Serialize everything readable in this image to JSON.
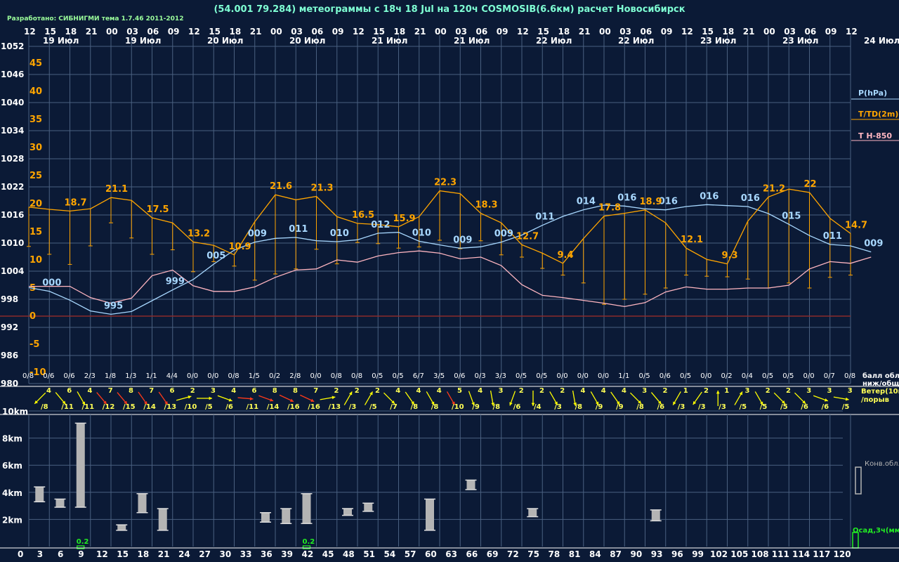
{
  "header": {
    "title": "(54.001 79.284) метеограммы с  18ч 18 Jul на 120ч COSMOSIB(6.6км) расчет Новосибирск",
    "credit": "Разработано: СИБНИГМИ тема 1.7.46 2011-2012"
  },
  "colors": {
    "background": "#0b1a36",
    "grid": "#4a6080",
    "pressure": "#a8d8ff",
    "temperature": "#ffa500",
    "t850": "#ffb6c1",
    "zero_line": "#8b2a2a",
    "wind_yellow": "#ffff00",
    "wind_red": "#ff3a1a",
    "cloud_bars": "#b4b4b4",
    "precip": "#22ee22"
  },
  "chart_data": {
    "type": "line",
    "hour_ticks": [
      "12",
      "15",
      "18",
      "21",
      "00",
      "03",
      "06",
      "09",
      "12",
      "15",
      "18",
      "21",
      "00",
      "03",
      "06",
      "09",
      "12",
      "15",
      "18",
      "21",
      "00",
      "03",
      "06",
      "09",
      "12",
      "15",
      "18",
      "21",
      "00",
      "03",
      "06",
      "09",
      "12",
      "15",
      "18",
      "21",
      "00",
      "03",
      "06",
      "09",
      "12"
    ],
    "date_labels": [
      "19 Июл",
      "19 Июл",
      "20 Июл",
      "20 Июл",
      "21 Июл",
      "21 Июл",
      "22 Июл",
      "22 Июл",
      "23 Июл",
      "23 Июл",
      "24 Июл"
    ],
    "pressure_axis": {
      "label": "P(hPa)",
      "ticks": [
        "1052",
        "1046",
        "1040",
        "1034",
        "1028",
        "1022",
        "1016",
        "1010",
        "1004",
        "998",
        "992",
        "986",
        "980"
      ]
    },
    "temperature_axis": {
      "label": "T/TD(2m)",
      "ticks": [
        "45",
        "40",
        "35",
        "30",
        "25",
        "20",
        "15",
        "10",
        "5",
        "0",
        "-5",
        "-10"
      ]
    },
    "t850_label": "T H-850",
    "pressure_labels": [
      {
        "i": 1,
        "t": "000"
      },
      {
        "i": 4,
        "t": "995"
      },
      {
        "i": 7,
        "t": "999"
      },
      {
        "i": 9,
        "t": "005"
      },
      {
        "i": 11,
        "t": "009"
      },
      {
        "i": 13,
        "t": "011"
      },
      {
        "i": 15,
        "t": "010"
      },
      {
        "i": 17,
        "t": "012"
      },
      {
        "i": 19,
        "t": "010"
      },
      {
        "i": 21,
        "t": "009"
      },
      {
        "i": 23,
        "t": "009"
      },
      {
        "i": 25,
        "t": "011"
      },
      {
        "i": 27,
        "t": "014"
      },
      {
        "i": 29,
        "t": "016"
      },
      {
        "i": 31,
        "t": "016"
      },
      {
        "i": 33,
        "t": "016"
      },
      {
        "i": 35,
        "t": "016"
      },
      {
        "i": 37,
        "t": "015"
      },
      {
        "i": 39,
        "t": "011"
      },
      {
        "i": 41,
        "t": "009"
      }
    ],
    "pressure_hpa": [
      1000.5,
      999.7,
      997.8,
      995.5,
      994.8,
      995.4,
      997.7,
      1000.0,
      1002.2,
      1005.5,
      1008.5,
      1010.2,
      1011.0,
      1011.2,
      1010.5,
      1010.3,
      1010.7,
      1012.1,
      1012.3,
      1010.4,
      1009.6,
      1008.9,
      1009.2,
      1010.2,
      1011.7,
      1013.8,
      1015.7,
      1017.1,
      1018.1,
      1017.9,
      1017.3,
      1017.1,
      1017.8,
      1018.2,
      1018.0,
      1017.8,
      1016.3,
      1014.0,
      1011.6,
      1009.7,
      1009.4,
      1008.1
    ],
    "temperature_c": [
      19.4,
      19.0,
      18.7,
      19.1,
      21.1,
      20.6,
      17.5,
      16.6,
      13.2,
      12.6,
      10.9,
      16.8,
      21.6,
      20.7,
      21.3,
      17.7,
      16.5,
      16.3,
      15.9,
      17.7,
      22.3,
      21.8,
      18.3,
      16.6,
      12.7,
      11.2,
      9.4,
      13.8,
      17.8,
      18.3,
      18.9,
      16.6,
      12.1,
      10.1,
      9.3,
      16.9,
      21.2,
      22.6,
      22.0,
      17.4,
      14.7
    ],
    "dewpoint_c": [
      12.4,
      11.0,
      9.2,
      12.5,
      16.6,
      13.9,
      11.0,
      11.8,
      7.9,
      9.7,
      8.9,
      6.4,
      7.5,
      8.4,
      11.9,
      9.3,
      13.1,
      12.9,
      12.1,
      12.3,
      13.5,
      12.0,
      13.4,
      10.9,
      10.5,
      8.5,
      7.3,
      5.9,
      2.1,
      3.0,
      3.9,
      5.0,
      7.3,
      7.1,
      7.0,
      6.6,
      5.0,
      5.9,
      5.0,
      6.9,
      7.3
    ],
    "temperature_labels": [
      {
        "i": 2,
        "t": "18.7"
      },
      {
        "i": 4,
        "t": "21.1"
      },
      {
        "i": 6,
        "t": "17.5"
      },
      {
        "i": 8,
        "t": "13.2"
      },
      {
        "i": 10,
        "t": "10.9"
      },
      {
        "i": 12,
        "t": "21.6"
      },
      {
        "i": 14,
        "t": "21.3"
      },
      {
        "i": 16,
        "t": "16.5"
      },
      {
        "i": 18,
        "t": "15.9"
      },
      {
        "i": 20,
        "t": "22.3"
      },
      {
        "i": 22,
        "t": "18.3"
      },
      {
        "i": 24,
        "t": "12.7"
      },
      {
        "i": 26,
        "t": "9.4"
      },
      {
        "i": 28,
        "t": "17.8"
      },
      {
        "i": 30,
        "t": "18.9"
      },
      {
        "i": 32,
        "t": "12.1"
      },
      {
        "i": 34,
        "t": "9.3"
      },
      {
        "i": 36,
        "t": "21.2"
      },
      {
        "i": 38,
        "t": "22"
      },
      {
        "i": 40,
        "t": "14.7"
      }
    ],
    "t850_c": [
      5.3,
      5.3,
      5.3,
      3.3,
      2.3,
      3.2,
      7.2,
      8.2,
      5.4,
      4.4,
      4.4,
      5.2,
      6.9,
      8.2,
      8.4,
      10.0,
      9.6,
      10.7,
      11.3,
      11.6,
      11.2,
      10.2,
      10.5,
      9.0,
      5.6,
      3.7,
      3.3,
      2.8,
      2.3,
      1.7,
      2.4,
      4.3,
      5.2,
      4.8,
      4.8,
      5.0,
      5.0,
      5.5,
      8.4,
      9.7,
      9.4,
      10.5
    ],
    "cloud_cover": [
      "0/8",
      "0/6",
      "0/6",
      "2/3",
      "1/8",
      "1/3",
      "1/1",
      "4/4",
      "0/0",
      "0/0",
      "0/8",
      "1/5",
      "0/2",
      "2/8",
      "0/0",
      "0/8",
      "0/8",
      "0/5",
      "0/5",
      "6/7",
      "3/5",
      "0/6",
      "0/3",
      "3/3",
      "0/5",
      "0/5",
      "0/0",
      "0/0",
      "0/0",
      "1/1",
      "0/5",
      "0/6",
      "0/5",
      "0/0",
      "0/2",
      "0/4",
      "0/5",
      "0/5",
      "0/0",
      "0/7",
      "0/8"
    ],
    "cloud_label": "балл обл. ниж/общ",
    "wind": [
      {
        "s": "4",
        "g": "/8",
        "a": 225,
        "c": "y"
      },
      {
        "s": "6",
        "g": "/11",
        "a": 140,
        "c": "y"
      },
      {
        "s": "4",
        "g": "/11",
        "a": 150,
        "c": "y"
      },
      {
        "s": "7",
        "g": "/12",
        "a": 140,
        "c": "r"
      },
      {
        "s": "8",
        "g": "/15",
        "a": 140,
        "c": "r"
      },
      {
        "s": "7",
        "g": "/14",
        "a": 145,
        "c": "r"
      },
      {
        "s": "6",
        "g": "/13",
        "a": 145,
        "c": "r"
      },
      {
        "s": "2",
        "g": "/10",
        "a": 75,
        "c": "y"
      },
      {
        "s": "3",
        "g": "/5",
        "a": 90,
        "c": "y"
      },
      {
        "s": "4",
        "g": "/6",
        "a": 110,
        "c": "y"
      },
      {
        "s": "6",
        "g": "/11",
        "a": 95,
        "c": "r"
      },
      {
        "s": "8",
        "g": "/14",
        "a": 110,
        "c": "r"
      },
      {
        "s": "8",
        "g": "/16",
        "a": 115,
        "c": "r"
      },
      {
        "s": "7",
        "g": "/16",
        "a": 115,
        "c": "r"
      },
      {
        "s": "2",
        "g": "/13",
        "a": 80,
        "c": "y"
      },
      {
        "s": "2",
        "g": "/3",
        "a": 30,
        "c": "y"
      },
      {
        "s": "2",
        "g": "/5",
        "a": 30,
        "c": "y"
      },
      {
        "s": "4",
        "g": "/7",
        "a": 135,
        "c": "y"
      },
      {
        "s": "4",
        "g": "/8",
        "a": 145,
        "c": "y"
      },
      {
        "s": "4",
        "g": "/8",
        "a": 150,
        "c": "y"
      },
      {
        "s": "5",
        "g": "/10",
        "a": 150,
        "c": "r"
      },
      {
        "s": "4",
        "g": "/9",
        "a": 160,
        "c": "y"
      },
      {
        "s": "3",
        "g": "/8",
        "a": 170,
        "c": "y"
      },
      {
        "s": "2",
        "g": "/6",
        "a": 200,
        "c": "y"
      },
      {
        "s": "2",
        "g": "/4",
        "a": 180,
        "c": "y"
      },
      {
        "s": "2",
        "g": "/3",
        "a": 150,
        "c": "y"
      },
      {
        "s": "4",
        "g": "/8",
        "a": 170,
        "c": "y"
      },
      {
        "s": "4",
        "g": "/9",
        "a": 150,
        "c": "y"
      },
      {
        "s": "4",
        "g": "/9",
        "a": 145,
        "c": "y"
      },
      {
        "s": "3",
        "g": "/8",
        "a": 135,
        "c": "y"
      },
      {
        "s": "2",
        "g": "/6",
        "a": 140,
        "c": "y"
      },
      {
        "s": "1",
        "g": "/3",
        "a": 210,
        "c": "y"
      },
      {
        "s": "2",
        "g": "/3",
        "a": 215,
        "c": "y"
      },
      {
        "s": "1",
        "g": "/3",
        "a": 0,
        "c": "y"
      },
      {
        "s": "3",
        "g": "/5",
        "a": 30,
        "c": "y"
      },
      {
        "s": "2",
        "g": "/5",
        "a": 150,
        "c": "y"
      },
      {
        "s": "2",
        "g": "/5",
        "a": 135,
        "c": "y"
      },
      {
        "s": "3",
        "g": "/6",
        "a": 135,
        "c": "y"
      },
      {
        "s": "3",
        "g": "/6",
        "a": 110,
        "c": "y"
      },
      {
        "s": "3",
        "g": "/5",
        "a": 100,
        "c": "y"
      }
    ],
    "wind_label_1": "Ветер(10м)",
    "wind_label_2": "/порыв",
    "cloud_axis": {
      "ticks": [
        "10km",
        "8km",
        "6km",
        "4km",
        "2km"
      ],
      "km": [
        10,
        8,
        6,
        4,
        2
      ]
    },
    "conv_label": "Конв.обл.",
    "precip_label": "Осад,3ч(мм)",
    "convective_clouds_km": [
      {
        "i": 1,
        "b": 3.3,
        "t": 4.4
      },
      {
        "i": 2,
        "b": 2.9,
        "t": 3.5
      },
      {
        "i": 3,
        "b": 2.9,
        "t": 9.1
      },
      {
        "i": 5,
        "b": 1.2,
        "t": 1.6
      },
      {
        "i": 6,
        "b": 2.5,
        "t": 3.9
      },
      {
        "i": 7,
        "b": 1.2,
        "t": 2.8
      },
      {
        "i": 12,
        "b": 1.8,
        "t": 2.5
      },
      {
        "i": 13,
        "b": 1.7,
        "t": 2.8
      },
      {
        "i": 14,
        "b": 1.7,
        "t": 3.9
      },
      {
        "i": 16,
        "b": 2.3,
        "t": 2.8
      },
      {
        "i": 17,
        "b": 2.6,
        "t": 3.2
      },
      {
        "i": 20,
        "b": 1.2,
        "t": 3.5
      },
      {
        "i": 22,
        "b": 4.2,
        "t": 4.9
      },
      {
        "i": 25,
        "b": 2.2,
        "t": 2.8
      },
      {
        "i": 31,
        "b": 1.9,
        "t": 2.7
      }
    ],
    "precip_mm": [
      {
        "i": 3,
        "v": "0.2"
      },
      {
        "i": 14,
        "v": "0.2"
      }
    ],
    "lead_hours": [
      "0",
      "3",
      "6",
      "9",
      "12",
      "15",
      "18",
      "21",
      "24",
      "27",
      "30",
      "33",
      "36",
      "39",
      "42",
      "45",
      "48",
      "51",
      "54",
      "57",
      "60",
      "63",
      "66",
      "69",
      "72",
      "75",
      "78",
      "81",
      "84",
      "87",
      "90",
      "93",
      "96",
      "99",
      "102",
      "105",
      "108",
      "111",
      "114",
      "117",
      "120"
    ]
  }
}
